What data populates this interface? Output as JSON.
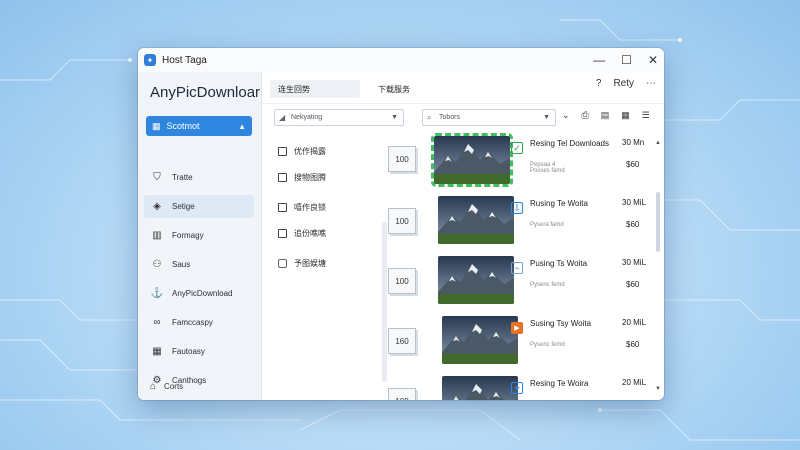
{
  "window": {
    "title": "Host Taga"
  },
  "titlebar": {
    "minimize": "—",
    "maximize": "☐",
    "close": "✕"
  },
  "sidebar": {
    "brand": "AnyPicDownloar",
    "select_label": "Scotmot",
    "items": [
      {
        "label": "Tratte",
        "icon": "shield-icon",
        "glyph": "⛉"
      },
      {
        "label": "Setige",
        "icon": "diamond-icon",
        "glyph": "◈"
      },
      {
        "label": "Formagy",
        "icon": "bar-chart-icon",
        "glyph": "▥"
      },
      {
        "label": "Saus",
        "icon": "user-icon",
        "glyph": "⚇"
      },
      {
        "label": "AnyPicDownload",
        "icon": "anchor-icon",
        "glyph": "⚓"
      },
      {
        "label": "Famccaspy",
        "icon": "link-icon",
        "glyph": "∞"
      },
      {
        "label": "Fautoasy",
        "icon": "calendar-icon",
        "glyph": "▦"
      },
      {
        "label": "Canthogs",
        "icon": "gear-icon",
        "glyph": "⚙"
      }
    ],
    "footer": {
      "label": "Corts",
      "icon": "home-icon",
      "glyph": "⌂"
    }
  },
  "topbar": {
    "tab1": "连生回势",
    "tab2": "下载服务",
    "icons": [
      {
        "name": "help-icon",
        "glyph": "?"
      },
      {
        "name": "profile-text",
        "glyph": "Rety"
      },
      {
        "name": "more-icon",
        "glyph": "⋯"
      }
    ]
  },
  "toolbar": {
    "left_dropdown": "Nekyating",
    "right_dropdown": "Tobors",
    "icons": [
      {
        "name": "chevron-down-icon",
        "glyph": "⌄"
      },
      {
        "name": "print-icon",
        "glyph": "⎙"
      },
      {
        "name": "save-icon",
        "glyph": "▤"
      },
      {
        "name": "grid-view-icon",
        "glyph": "▦"
      },
      {
        "name": "list-view-icon",
        "glyph": "☰"
      }
    ]
  },
  "left_panel": {
    "items": [
      {
        "label": "优作揭露"
      },
      {
        "label": "搜物图腾"
      },
      {
        "label": "嘻作良锁"
      },
      {
        "label": "追份噍噍"
      },
      {
        "label": "予图娱塘"
      }
    ]
  },
  "downloads": [
    {
      "badge": "100",
      "title": "Resing Tel Downloads",
      "subtitle": "Pepsaa 4\nPosses famd",
      "size": "30 Mn",
      "res": "$60",
      "status_icon": "check-icon",
      "status_glyph": "✓",
      "selected": true
    },
    {
      "badge": "100",
      "title": "Rusing Te Woita",
      "subtitle": "Pysera famd",
      "size": "30 MiL",
      "res": "$60",
      "status_icon": "download-icon",
      "status_glyph": "⇩",
      "selected": false
    },
    {
      "badge": "100",
      "title": "Pusing Ts Woita",
      "subtitle": "Pysenc femd",
      "size": "30 MiL",
      "res": "$60",
      "status_icon": "tag-icon",
      "status_glyph": "⌁",
      "selected": false
    },
    {
      "badge": "160",
      "title": "Susing Tsy Woita",
      "subtitle": "Pysenc femd",
      "size": "20 MiL",
      "res": "$60",
      "status_icon": "play-icon",
      "status_glyph": "▶",
      "selected": false
    },
    {
      "badge": "100",
      "title": "Resing Te Woira",
      "subtitle": "",
      "size": "20 MiL",
      "res": "",
      "status_icon": "bird-icon",
      "status_glyph": "✦",
      "selected": false
    }
  ],
  "colors": {
    "accent": "#2f86df",
    "selection_outline": "#3fbf5f",
    "check_green": "#2fa64e",
    "play_orange": "#e8742a",
    "download_blue": "#2f86df"
  }
}
